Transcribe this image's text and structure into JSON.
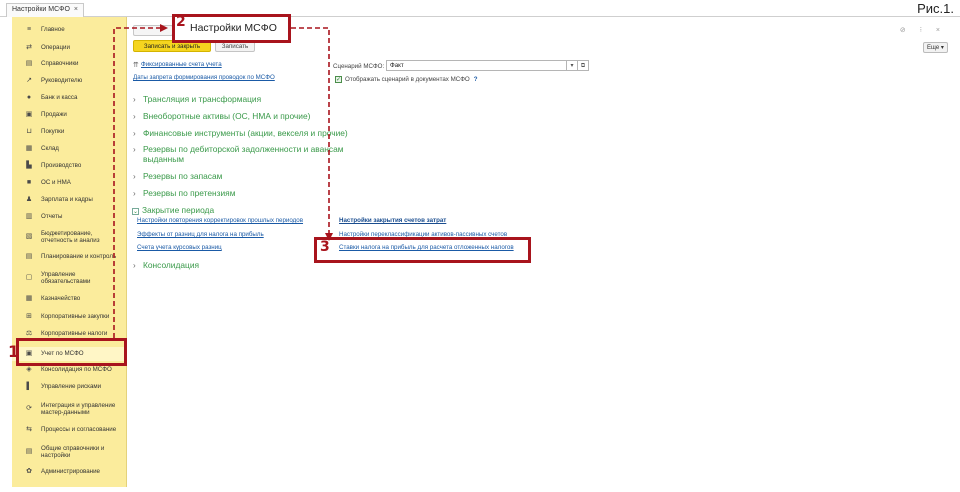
{
  "tab": {
    "label": "Настройки МСФО",
    "close": "×"
  },
  "figure_label": "Рис.1.",
  "sidebar": {
    "items": [
      {
        "label": "Главное",
        "icon": "≡",
        "icon_name": "menu-icon"
      },
      {
        "label": "Операции",
        "icon": "⇄",
        "icon_name": "operations-icon"
      },
      {
        "label": "Справочники",
        "icon": "▤",
        "icon_name": "book-icon"
      },
      {
        "label": "Руководителю",
        "icon": "↗",
        "icon_name": "chart-trend-icon"
      },
      {
        "label": "Банк и касса",
        "icon": "●",
        "icon_name": "bank-icon"
      },
      {
        "label": "Продажи",
        "icon": "▣",
        "icon_name": "shopping-bag-icon"
      },
      {
        "label": "Покупки",
        "icon": "⊔",
        "icon_name": "cart-icon"
      },
      {
        "label": "Склад",
        "icon": "▦",
        "icon_name": "warehouse-icon"
      },
      {
        "label": "Производство",
        "icon": "▙",
        "icon_name": "factory-icon"
      },
      {
        "label": "ОС и НМА",
        "icon": "■",
        "icon_name": "truck-icon"
      },
      {
        "label": "Зарплата и кадры",
        "icon": "♟",
        "icon_name": "people-icon"
      },
      {
        "label": "Отчеты",
        "icon": "▥",
        "icon_name": "report-icon"
      },
      {
        "label": "Бюджетирование,",
        "label2": "отчетность и анализ",
        "icon": "▧",
        "icon_name": "budget-icon"
      },
      {
        "label": "Планирование и контроль",
        "icon": "▤",
        "icon_name": "planning-icon"
      },
      {
        "label": "Управление",
        "label2": "обязательствами",
        "icon": "▢",
        "icon_name": "obligations-icon"
      },
      {
        "label": "Казначейство",
        "icon": "▦",
        "icon_name": "treasury-icon"
      },
      {
        "label": "Корпоративные закупки",
        "icon": "⊞",
        "icon_name": "procurement-icon"
      },
      {
        "label": "Корпоративные налоги",
        "icon": "⚖",
        "icon_name": "taxes-icon"
      },
      {
        "label": "Учет по МСФО",
        "icon": "▣",
        "icon_name": "ifrs-icon"
      },
      {
        "label": "Консолидация по МСФО",
        "icon": "◈",
        "icon_name": "consolidation-icon"
      },
      {
        "label": "Управление рисками",
        "icon": "▌",
        "icon_name": "risk-icon"
      },
      {
        "label": "Интеграция и управление",
        "label2": "мастер-данными",
        "icon": "⟳",
        "icon_name": "integration-icon"
      },
      {
        "label": "Процессы и согласование",
        "icon": "⇆",
        "icon_name": "process-icon"
      },
      {
        "label": "Общие справочники и",
        "label2": "настройки",
        "icon": "▤",
        "icon_name": "settings-book-icon"
      },
      {
        "label": "Администрирование",
        "icon": "✿",
        "icon_name": "gear-icon"
      }
    ]
  },
  "toolbar": {
    "save_close": "Записать и закрыть",
    "save": "Записать",
    "more": "Еще ▾"
  },
  "window_controls": "⊘ ⁝ ×",
  "links": {
    "fixed_accounts": "Фиксированные счета учета",
    "period_close_dates": "Даты запрета формирования проводок по МСФО"
  },
  "groups": [
    {
      "label": "Трансляция и трансформация"
    },
    {
      "label": "Внеоборотные активы (ОС, НМА и прочие)"
    },
    {
      "label": "Финансовые инструменты (акции, векселя и прочие)"
    },
    {
      "label": "Резервы по дебиторской задолженности и авансам",
      "label2": "выданным"
    },
    {
      "label": "Резервы по запасам"
    },
    {
      "label": "Резервы по претензиям"
    },
    {
      "label": "Закрытие периода"
    },
    {
      "label": "Консолидация"
    }
  ],
  "period_close": {
    "left_links": [
      "Настройки повторения корректировок прошлых периодов",
      "Эффекты от разниц для налога на прибыль",
      "Счета учета курсовых разниц"
    ],
    "right_links": [
      "Настройки закрытия счетов затрат",
      "Настройки переклассификации активов-пассивных счетов",
      "Ставки налога на прибыль для расчета отложенных налогов"
    ]
  },
  "scenario": {
    "label": "Сценарий МСФО:",
    "value": "Факт",
    "dropdown": "▾",
    "open": "⧉"
  },
  "show_scenarios": {
    "label": "Отображать сценарий в документах МСФО",
    "checked": "✓",
    "help": "?"
  },
  "callouts": {
    "one": "1",
    "two": "2",
    "two_title": "Настройки МСФО",
    "three": "3"
  },
  "colors": {
    "accent_red": "#a8141d",
    "sidebar_yellow": "#fbec9c",
    "button_yellow": "#f5d51f",
    "group_green": "#3a9a4a",
    "link_blue": "#1a5aa6"
  }
}
